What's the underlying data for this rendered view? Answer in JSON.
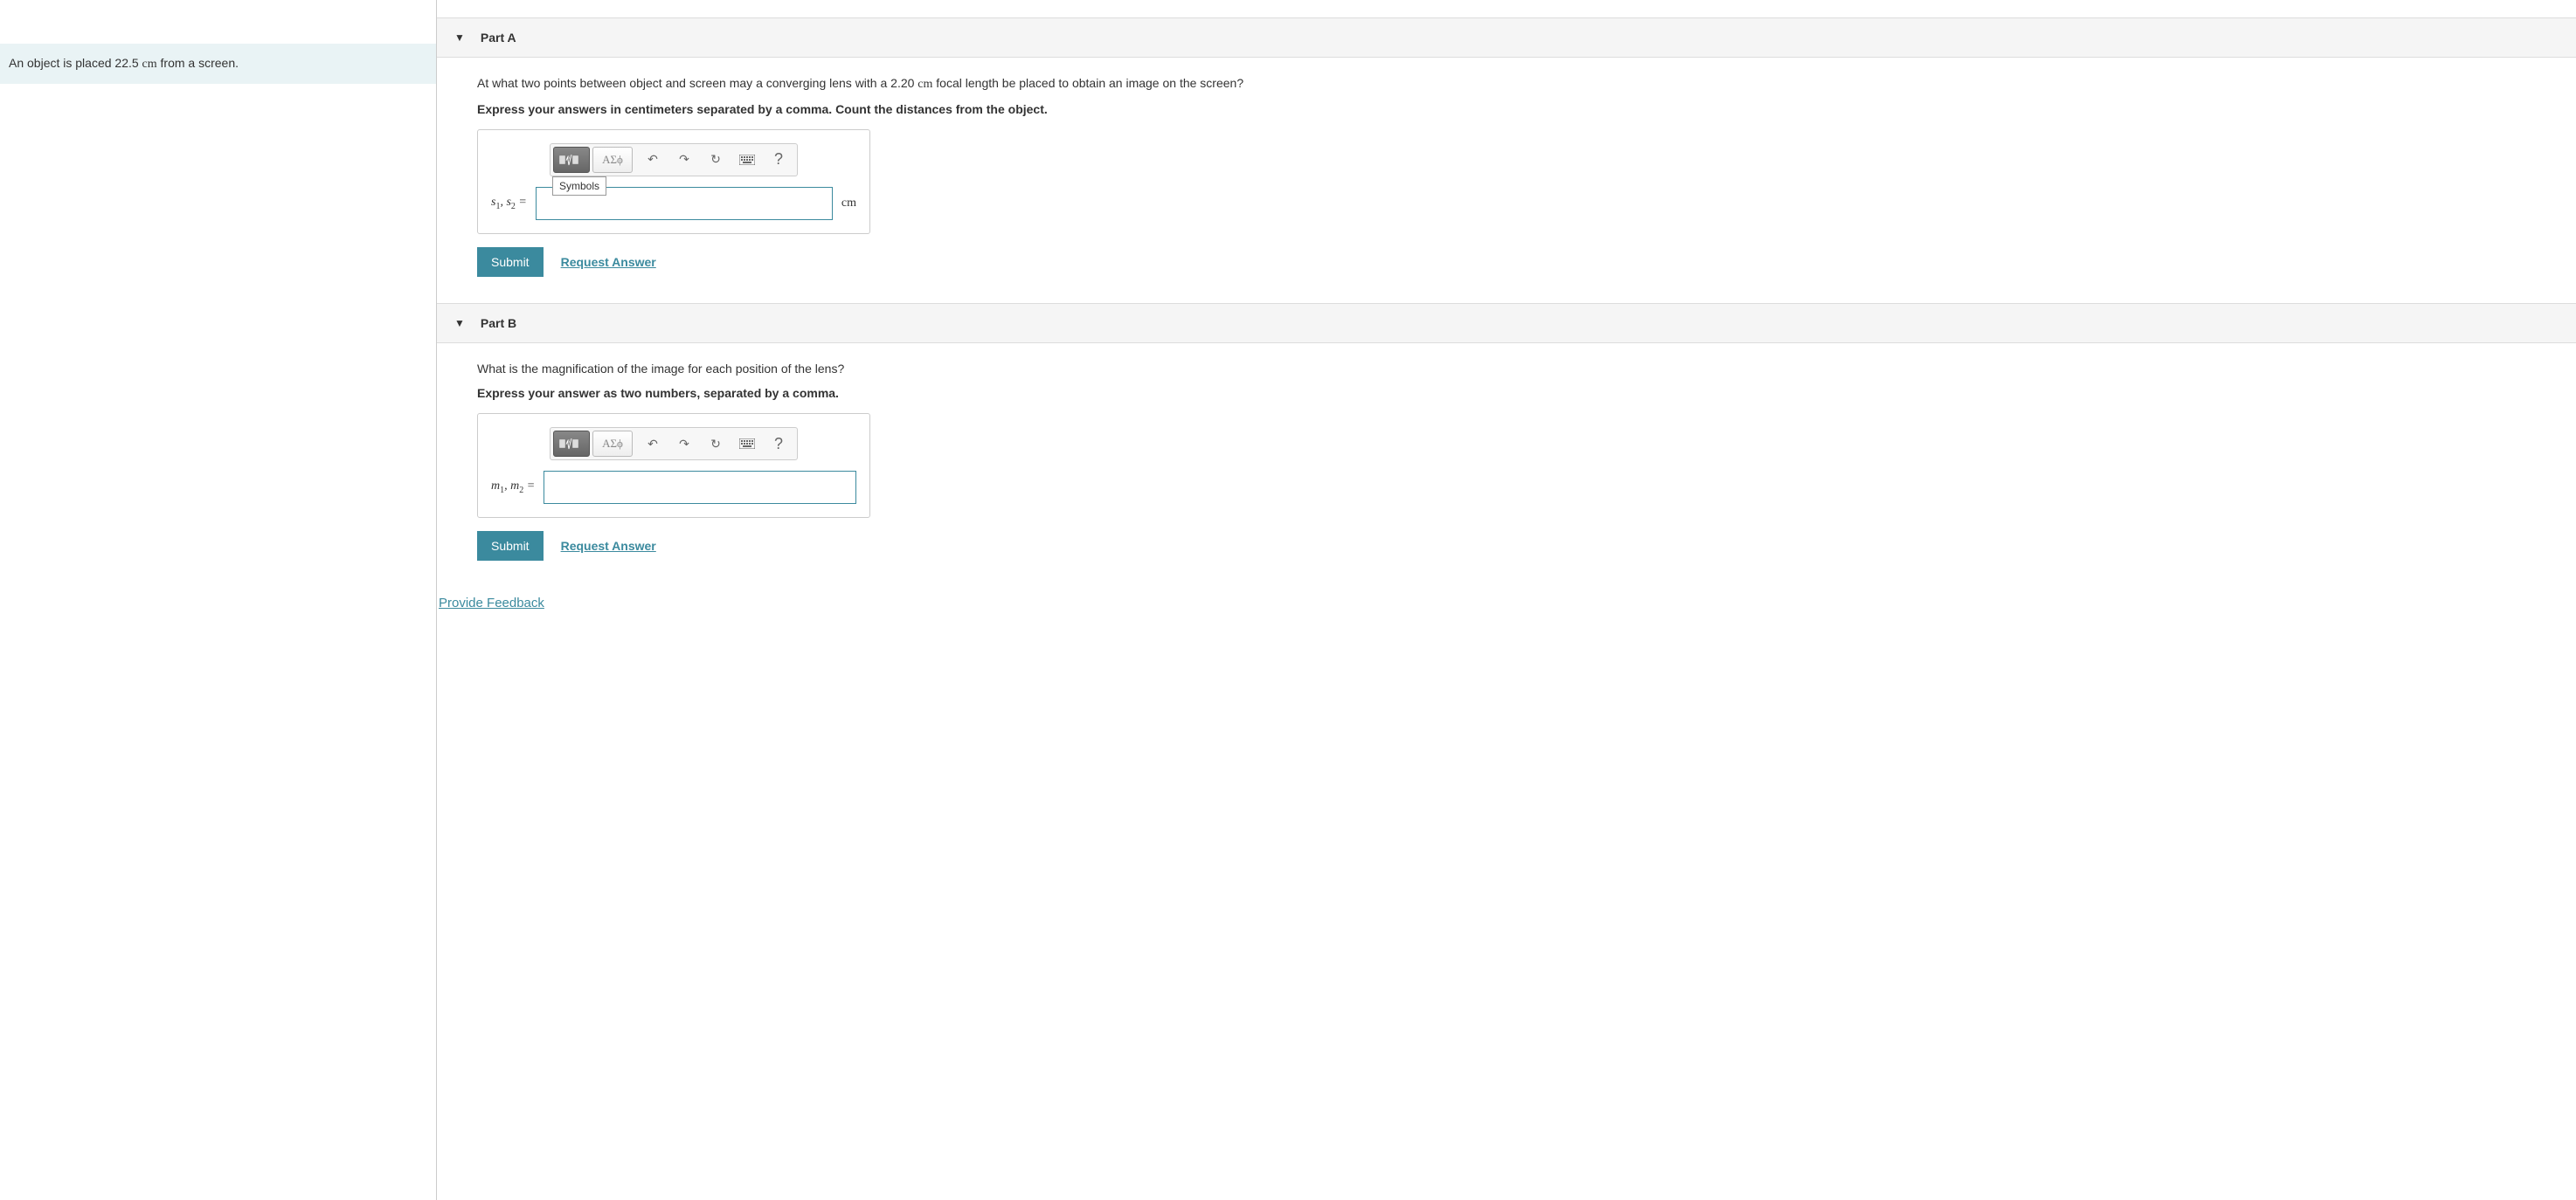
{
  "problem": {
    "text_before": "An object is placed 22.5 ",
    "unit": "cm",
    "text_after": " from a screen."
  },
  "part_a": {
    "title": "Part A",
    "question_before": "At what two points between object and screen may a converging lens with a 2.20 ",
    "question_unit": "cm",
    "question_after": " focal length be placed to obtain an image on the screen?",
    "instruction": "Express your answers in centimeters separated by a comma. Count the distances from the object.",
    "var_label_html": "s₁, s₂ =",
    "unit": "cm",
    "tooltip": "Symbols",
    "symbols_btn": "ΑΣϕ",
    "submit": "Submit",
    "request": "Request Answer",
    "input_value": ""
  },
  "part_b": {
    "title": "Part B",
    "question": "What is the magnification of the image for each position of the lens?",
    "instruction": "Express your answer as two numbers, separated by a comma.",
    "var_label_html": "m₁, m₂ =",
    "symbols_btn": "ΑΣϕ",
    "submit": "Submit",
    "request": "Request Answer",
    "input_value": ""
  },
  "feedback": "Provide Feedback",
  "icons": {
    "undo": "↶",
    "redo": "↷",
    "reset": "↻",
    "help": "?",
    "keyboard": "⌨"
  }
}
